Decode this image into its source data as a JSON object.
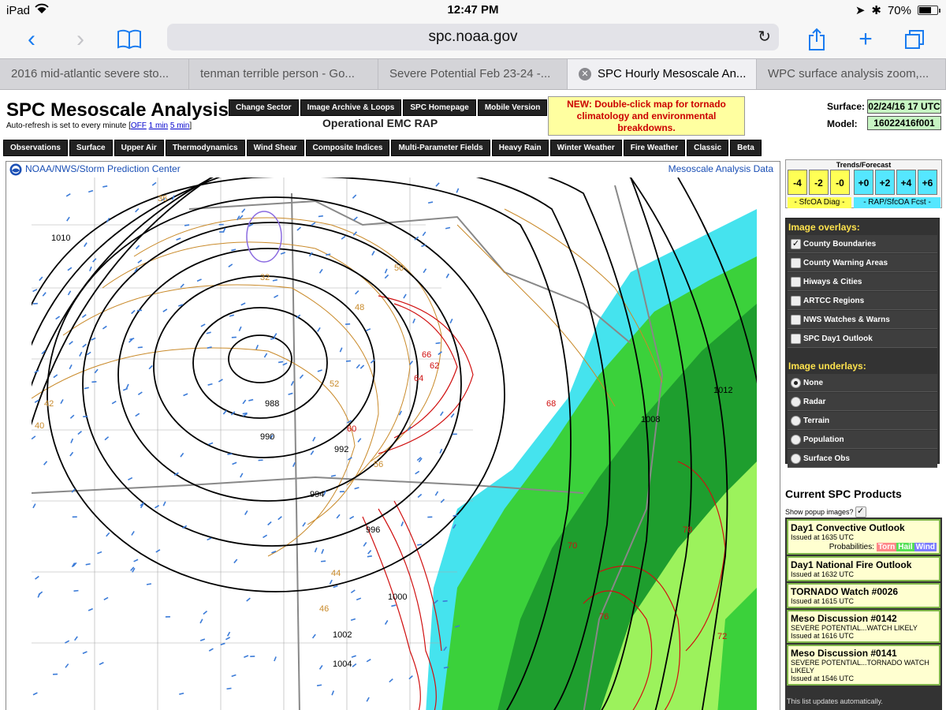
{
  "status": {
    "device": "iPad",
    "time": "12:47 PM",
    "battery": "70%",
    "battery_level": 0.7
  },
  "browser": {
    "url": "spc.noaa.gov",
    "tabs": [
      {
        "title": "2016 mid-atlantic severe sto...",
        "active": false
      },
      {
        "title": "tenman terrible person - Go...",
        "active": false
      },
      {
        "title": "Severe Potential Feb 23-24 -...",
        "active": false
      },
      {
        "title": "SPC Hourly Mesoscale An...",
        "active": true
      },
      {
        "title": "WPC surface analysis zoom,...",
        "active": false
      }
    ]
  },
  "page": {
    "title": "SPC Mesoscale Analysis",
    "autorefresh_text": "Auto-refresh is set to every minute [",
    "autorefresh_links": [
      "OFF",
      "1 min",
      "5 min"
    ],
    "autorefresh_end": "]",
    "top_buttons": [
      "Change Sector",
      "Image Archive & Loops",
      "SPC Homepage",
      "Mobile Version"
    ],
    "model_title": "Operational EMC RAP",
    "notice": "NEW: Double-click map for tornado climatology and environmental breakdowns.",
    "surface_label": "Surface:",
    "surface_value": "02/24/16 17 UTC",
    "model_label": "Model:",
    "model_value": "16022416f001",
    "nav": [
      "Observations",
      "Surface",
      "Upper Air",
      "Thermodynamics",
      "Wind Shear",
      "Composite Indices",
      "Multi-Parameter Fields",
      "Heavy Rain",
      "Winter Weather",
      "Fire Weather",
      "Classic",
      "Beta"
    ]
  },
  "map": {
    "header_left": "NOAA/NWS/Storm Prediction Center",
    "header_right": "Mesoscale Analysis Data",
    "isobar_labels": [
      "988",
      "990",
      "992",
      "994",
      "996",
      "1000",
      "1002",
      "1004",
      "1008",
      "1010",
      "1012"
    ],
    "dewpoint_labels": [
      "60",
      "62",
      "64",
      "66",
      "68",
      "70",
      "72",
      "76",
      "78"
    ],
    "temp_labels": [
      "32",
      "36",
      "40",
      "42",
      "44",
      "46",
      "48",
      "50",
      "52",
      "56"
    ],
    "colors": {
      "teal": "#45e3ee",
      "green_light": "#9cf25c",
      "green": "#3bd13b",
      "green_dark": "#1e9e2e",
      "isobar": "#000000",
      "dewpoint": "#d01010",
      "temp": "#c98a2a",
      "wind": "#3b7bd8"
    }
  },
  "trends": {
    "title": "Trends/Forecast",
    "past": [
      "-4",
      "-2",
      "-0"
    ],
    "future": [
      "+0",
      "+2",
      "+4",
      "+6"
    ],
    "past_caption": "- SfcOA Diag -",
    "future_caption": "- RAP/SfcOA Fcst -"
  },
  "overlays": {
    "heading": "Image overlays:",
    "items": [
      {
        "label": "County Boundaries",
        "checked": true
      },
      {
        "label": "County Warning Areas",
        "checked": false
      },
      {
        "label": "Hiways & Cities",
        "checked": false
      },
      {
        "label": "ARTCC Regions",
        "checked": false
      },
      {
        "label": "NWS Watches & Warns",
        "checked": false
      },
      {
        "label": "SPC Day1 Outlook",
        "checked": false
      }
    ]
  },
  "underlays": {
    "heading": "Image underlays:",
    "items": [
      {
        "label": "None",
        "selected": true
      },
      {
        "label": "Radar",
        "selected": false
      },
      {
        "label": "Terrain",
        "selected": false
      },
      {
        "label": "Population",
        "selected": false
      },
      {
        "label": "Surface Obs",
        "selected": false
      }
    ]
  },
  "products": {
    "heading": "Current SPC Products",
    "popup_label": "Show popup images?",
    "items": [
      {
        "title": "Day1 Convective Outlook",
        "subtitle": "Issued at 1635 UTC",
        "probabilities_label": "Probabilities:",
        "probabilities": [
          "Torn",
          "Hail",
          "Wind"
        ]
      },
      {
        "title": "Day1 National Fire Outlook",
        "subtitle": "Issued at 1632 UTC"
      },
      {
        "title": "TORNADO Watch #0026",
        "subtitle": "Issued at 1615 UTC"
      },
      {
        "title": "Meso Discussion #0142",
        "subtitle": "SEVERE POTENTIAL...WATCH LIKELY",
        "issued": "Issued at 1616 UTC"
      },
      {
        "title": "Meso Discussion #0141",
        "subtitle": "SEVERE POTENTIAL...TORNADO WATCH LIKELY",
        "issued": "Issued at 1546 UTC"
      }
    ],
    "footer": "This list updates automatically."
  }
}
